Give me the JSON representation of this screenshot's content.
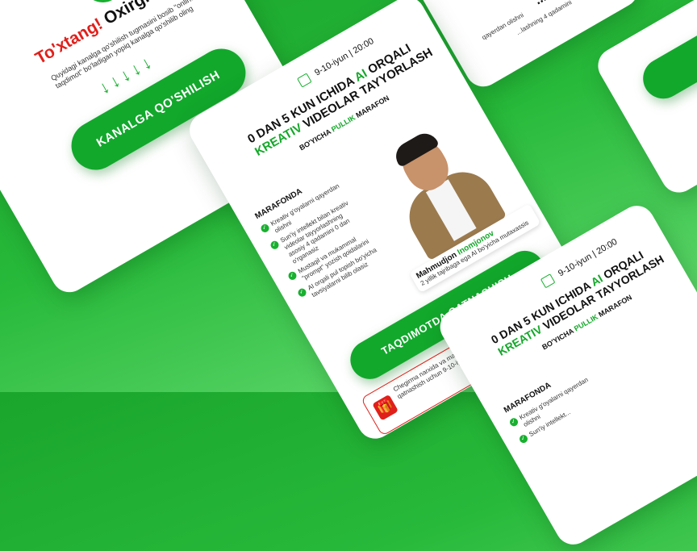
{
  "card_left": {
    "warn_red": "To'xtang!",
    "warn_black": "Oxirgi qadam qoldi!",
    "instruction": "Quyidagi kanalga qo'shilish tugmasini bosib \"online taqdimot\" bo'ladigan yopiq kanalga qo'shilib oling",
    "join_button": "KANALGA QO'SHILISH"
  },
  "card_main": {
    "date": "9-10-iyun",
    "time": "20:00",
    "title_line1_a": "0 DAN 5 KUN ICHIDA ",
    "title_ai": "AI",
    "title_line1_b": " ORQALI",
    "title_kreativ": "KREATIV",
    "title_line2": " VIDEOLAR TAYYORLASH",
    "subtitle_a": "BO'YICHA ",
    "subtitle_pullik": "PULLIK",
    "subtitle_b": " MARAFON",
    "section_heading": "MARAFONDA",
    "bullets": [
      "Kreativ g'oyalarni qayerdan olishni",
      "Sun'iy intellekt bilan kreativ videolar tayyorlashning asosiy 4 qadamini 0 dan o'rganasiz",
      "Mustaqil va mukammal \"prompt\" yozish qoidalarini",
      "AI orqali pul topish bo'yicha tavsiyalarni bilib olasiz"
    ],
    "speaker_name_a": "Mahmudjon ",
    "speaker_name_b": "Inomjonov",
    "speaker_desc": "2 yillik tajribaga ega AI bo'yicha mutaxassis",
    "cta_button": "TAQDIMOTDA QATNASHISH",
    "gift_text": "Chegirma narxida va maxsus taklifda 5 kunlik onlayn marafonda qatnashish uchun 9-10-iyun onlayn taqdimotida ishtirok eting!"
  },
  "card_top_right": {
    "text_a": "... bilib",
    "text_b": "qayerdan olishni",
    "text_c": "...lashning 4 qadamini"
  },
  "card_bottom_right": {
    "date": "9-10-iyun",
    "time": "20:00",
    "title_line1_a": "0 DAN 5 KUN ICHIDA ",
    "title_ai": "AI",
    "title_line1_b": " ORQALI",
    "title_kreativ": "KREATIV",
    "title_line2": " VIDEOLAR TAYYORLASH",
    "subtitle_a": "BO'YICHA ",
    "subtitle_pullik": "PULLIK",
    "subtitle_b": " MARAFON",
    "section_heading": "MARAFONDA",
    "bullets": [
      "Kreativ g'oyalarni qayerdan olishni",
      "Sun'iy intellekt..."
    ]
  },
  "colors": {
    "accent": "#14a82a",
    "warn": "#e0201b",
    "bg": "#1aa52c"
  }
}
